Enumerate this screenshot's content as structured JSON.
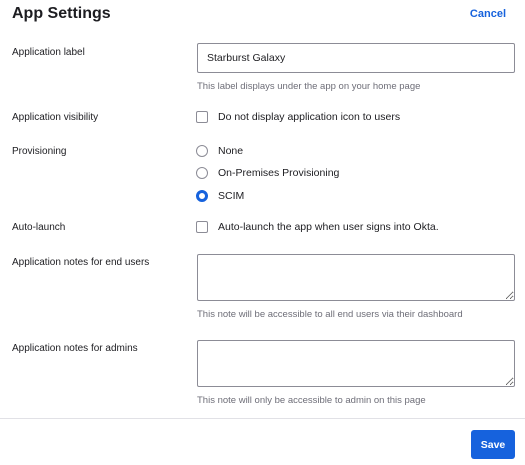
{
  "header": {
    "title": "App Settings",
    "cancel_label": "Cancel"
  },
  "fields": {
    "application_label": {
      "label": "Application label",
      "value": "Starburst Galaxy",
      "hint": "This label displays under the app on your home page"
    },
    "application_visibility": {
      "label": "Application visibility",
      "option_label": "Do not display application icon to users",
      "checked": false
    },
    "provisioning": {
      "label": "Provisioning",
      "options": [
        {
          "label": "None",
          "selected": false
        },
        {
          "label": "On-Premises Provisioning",
          "selected": false
        },
        {
          "label": "SCIM",
          "selected": true
        }
      ]
    },
    "auto_launch": {
      "label": "Auto-launch",
      "option_label": "Auto-launch the app when user signs into Okta.",
      "checked": false
    },
    "notes_end_users": {
      "label": "Application notes for end users",
      "value": "",
      "hint": "This note will be accessible to all end users via their dashboard"
    },
    "notes_admins": {
      "label": "Application notes for admins",
      "value": "",
      "hint": "This note will only be accessible to admin on this page"
    }
  },
  "footer": {
    "save_label": "Save"
  },
  "colors": {
    "accent": "#1662dd",
    "text": "#1d1d21",
    "hint": "#6e6e78",
    "border": "#8c8c96"
  }
}
